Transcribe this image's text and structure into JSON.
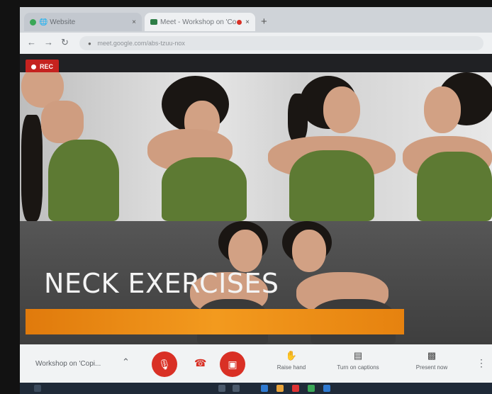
{
  "browser": {
    "tabs": [
      {
        "label": "🌐 Website",
        "close": "×"
      },
      {
        "label": "Meet - Workshop on 'Copi",
        "close": "×"
      }
    ],
    "new_tab": "+",
    "url": "meet.google.com/abs-tzuu-nox"
  },
  "meet": {
    "rec_label": "REC",
    "slide_title": "NECK EXERCISES",
    "meeting_name": "Workshop on 'Copi...",
    "toolbar": {
      "raise_hand": "Raise hand",
      "captions": "Turn on captions",
      "present": "Present now"
    }
  },
  "colors": {
    "accent_red": "#d93025",
    "bar_orange": "#f39a1e"
  }
}
